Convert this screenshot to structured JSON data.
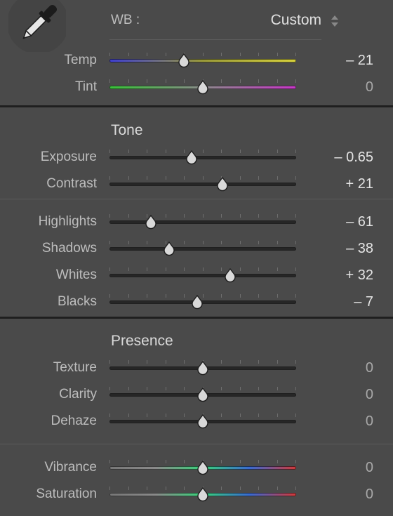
{
  "wb": {
    "label": "WB :",
    "value": "Custom",
    "icons": {
      "eyedropper": "eyedropper-icon",
      "updown": "updown-arrows-icon"
    },
    "sliders": [
      {
        "key": "temp",
        "label": "Temp",
        "value_text": "– 21",
        "value": -21,
        "min": -100,
        "max": 100,
        "fraction": 0.4,
        "gradient": [
          "#3f3fd0",
          "#9a9a3a",
          "#d6d03c"
        ]
      },
      {
        "key": "tint",
        "label": "Tint",
        "value_text": "0",
        "value": 0,
        "min": -150,
        "max": 150,
        "fraction": 0.5,
        "gradient": [
          "#3ac03a",
          "#8a8a8a",
          "#c73ac7"
        ]
      }
    ]
  },
  "tone": {
    "title": "Tone",
    "sliders_a": [
      {
        "key": "exposure",
        "label": "Exposure",
        "value_text": "– 0.65",
        "value": -0.65,
        "min": -5,
        "max": 5,
        "fraction": 0.44
      },
      {
        "key": "contrast",
        "label": "Contrast",
        "value_text": "+ 21",
        "value": 21,
        "min": -100,
        "max": 100,
        "fraction": 0.605
      }
    ],
    "sliders_b": [
      {
        "key": "highlights",
        "label": "Highlights",
        "value_text": "– 61",
        "value": -61,
        "min": -100,
        "max": 100,
        "fraction": 0.22
      },
      {
        "key": "shadows",
        "label": "Shadows",
        "value_text": "– 38",
        "value": -38,
        "min": -100,
        "max": 100,
        "fraction": 0.32
      },
      {
        "key": "whites",
        "label": "Whites",
        "value_text": "+ 32",
        "value": 32,
        "min": -100,
        "max": 100,
        "fraction": 0.645
      },
      {
        "key": "blacks",
        "label": "Blacks",
        "value_text": "– 7",
        "value": -7,
        "min": -100,
        "max": 100,
        "fraction": 0.47
      }
    ]
  },
  "presence": {
    "title": "Presence",
    "sliders_a": [
      {
        "key": "texture",
        "label": "Texture",
        "value_text": "0",
        "value": 0,
        "min": -100,
        "max": 100,
        "fraction": 0.5
      },
      {
        "key": "clarity",
        "label": "Clarity",
        "value_text": "0",
        "value": 0,
        "min": -100,
        "max": 100,
        "fraction": 0.5
      },
      {
        "key": "dehaze",
        "label": "Dehaze",
        "value_text": "0",
        "value": 0,
        "min": -100,
        "max": 100,
        "fraction": 0.5
      }
    ],
    "sliders_b": [
      {
        "key": "vibrance",
        "label": "Vibrance",
        "value_text": "0",
        "value": 0,
        "min": -100,
        "max": 100,
        "fraction": 0.5,
        "gradient": [
          "#777777",
          "#8a8a8a",
          "#3ad07a",
          "#3a6ad0",
          "#d03a3a"
        ]
      },
      {
        "key": "saturation",
        "label": "Saturation",
        "value_text": "0",
        "value": 0,
        "min": -100,
        "max": 100,
        "fraction": 0.5,
        "gradient": [
          "#777777",
          "#8a8a8a",
          "#3ad07a",
          "#3a6ad0",
          "#d03a3a"
        ]
      }
    ]
  }
}
